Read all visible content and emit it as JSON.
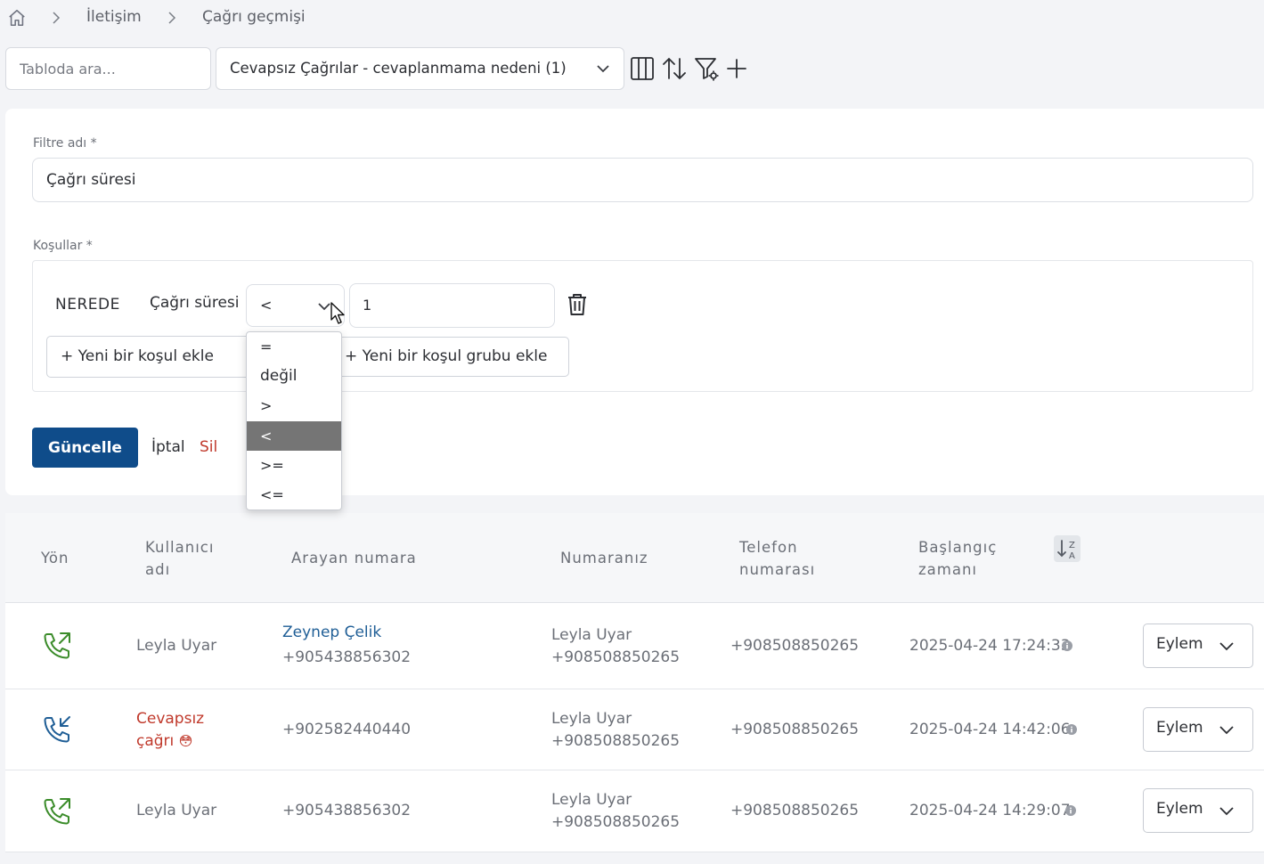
{
  "breadcrumb": {
    "items": [
      "İletişim",
      "Çağrı geçmişi"
    ]
  },
  "toolbar": {
    "search_placeholder": "Tabloda ara...",
    "view_selected": "Cevapsız Çağrılar - cevaplanmama nedeni (1)",
    "icons": [
      "columns-icon",
      "sort-icon",
      "filter-settings-icon",
      "plus-icon"
    ]
  },
  "filter_panel": {
    "name_label": "Filtre adı *",
    "name_value": "Çağrı süresi",
    "conditions_label": "Koşullar *",
    "condition": {
      "where_label": "NEREDE",
      "field_label": "Çağrı süresi",
      "operator_value": "<",
      "value": "1"
    },
    "add_condition_label": "+ Yeni bir koşul ekle",
    "add_group_label": "+ Yeni bir koşul grubu ekle",
    "update_label": "Güncelle",
    "cancel_label": "İptal",
    "delete_label": "Sil",
    "operator_options": [
      "=",
      "değil",
      ">",
      "<",
      ">=",
      "<="
    ],
    "operator_selected_index": 3
  },
  "table": {
    "headers": {
      "direction": "Yön",
      "username": [
        "Kullanıcı",
        "adı"
      ],
      "caller": "Arayan numara",
      "your_number": "Numaranız",
      "phone": [
        "Telefon",
        "numarası"
      ],
      "start": [
        "Başlangıç",
        "zamanı"
      ]
    },
    "action_label": "Eylem",
    "rows": [
      {
        "direction": "outgoing",
        "username": "Leyla Uyar",
        "caller_name": "Zeynep Çelik",
        "caller_number": "+905438856302",
        "your_name": "Leyla Uyar",
        "your_number": "+908508850265",
        "phone": "+908508850265",
        "start": "2025-04-24 17:24:33"
      },
      {
        "direction": "incoming",
        "username_line1": "Cevapsız",
        "username_line2": "çağrı",
        "username_emoji": "😳",
        "caller_number": "+902582440440",
        "your_name": "Leyla Uyar",
        "your_number": "+908508850265",
        "phone": "+908508850265",
        "start": "2025-04-24 14:42:06"
      },
      {
        "direction": "outgoing",
        "username": "Leyla Uyar",
        "caller_number": "+905438856302",
        "your_name": "Leyla Uyar",
        "your_number": "+908508850265",
        "phone": "+908508850265",
        "start": "2025-04-24 14:29:07"
      }
    ]
  },
  "colors": {
    "primary": "#0f4c8a",
    "link": "#1f5e96",
    "missed": "#c0392b",
    "call_outgoing": "#3b8c2a",
    "call_incoming": "#1f5e96"
  }
}
